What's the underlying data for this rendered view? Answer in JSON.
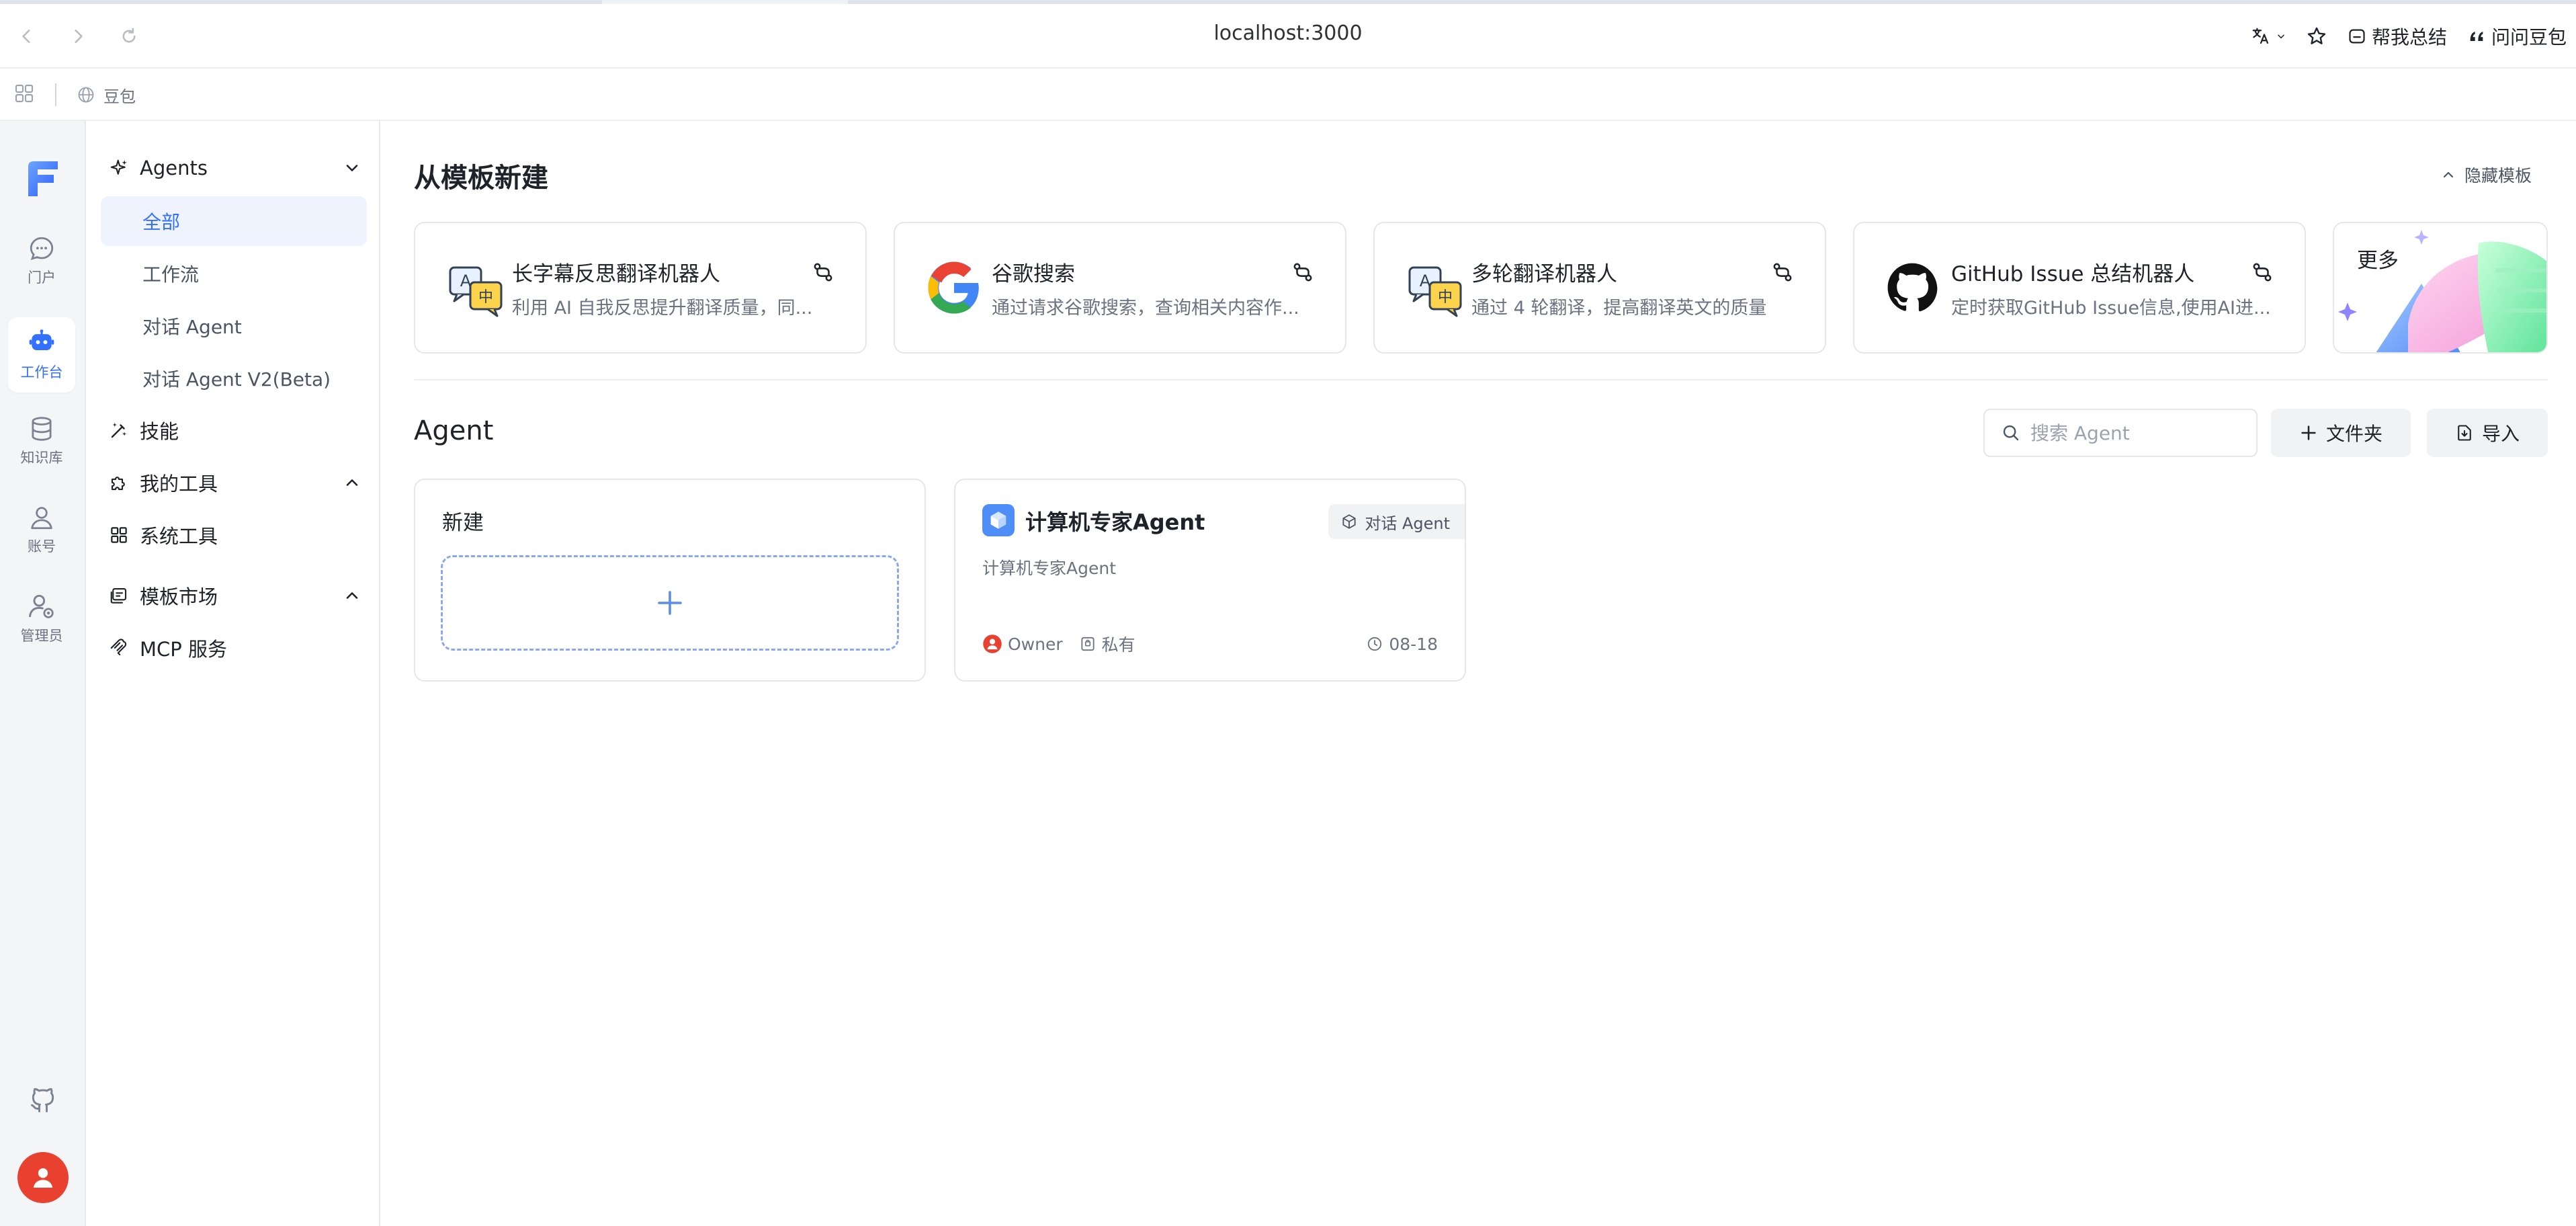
{
  "browser": {
    "url": "localhost:3000",
    "summarize_label": "帮我总结",
    "ask_label": "问问豆包",
    "bookmark_label": "豆包"
  },
  "rail": {
    "items": [
      {
        "label": "门户"
      },
      {
        "label": "工作台"
      },
      {
        "label": "知识库"
      },
      {
        "label": "账号"
      },
      {
        "label": "管理员"
      }
    ]
  },
  "menu": {
    "agents": "Agents",
    "all": "全部",
    "workflow": "工作流",
    "chat_agent": "对话 Agent",
    "chat_agent_v2": "对话 Agent V2(Beta)",
    "skills": "技能",
    "my_tools": "我的工具",
    "system_tools": "系统工具",
    "template_market": "模板市场",
    "mcp": "MCP 服务"
  },
  "templates": {
    "title": "从模板新建",
    "hide_label": "隐藏模板",
    "more_label": "更多",
    "cards": [
      {
        "title": "长字幕反思翻译机器人",
        "desc": "利用 AI 自我反思提升翻译质量，同..."
      },
      {
        "title": "谷歌搜索",
        "desc": "通过请求谷歌搜索，查询相关内容作..."
      },
      {
        "title": "多轮翻译机器人",
        "desc": "通过 4 轮翻译，提高翻译英文的质量"
      },
      {
        "title": "GitHub Issue 总结机器人",
        "desc": "定时获取GitHub Issue信息,使用AI进..."
      }
    ]
  },
  "agents": {
    "title": "Agent",
    "search_placeholder": "搜索 Agent",
    "folder_label": "文件夹",
    "import_label": "导入",
    "new_label": "新建",
    "card": {
      "name": "计算机专家Agent",
      "type": "对话 Agent",
      "desc": "计算机专家Agent",
      "owner": "Owner",
      "visibility": "私有",
      "date": "08-18"
    }
  },
  "colors": {
    "accent": "#3370ff",
    "active_bg": "#eef3fe",
    "avatar": "#e8412f"
  }
}
